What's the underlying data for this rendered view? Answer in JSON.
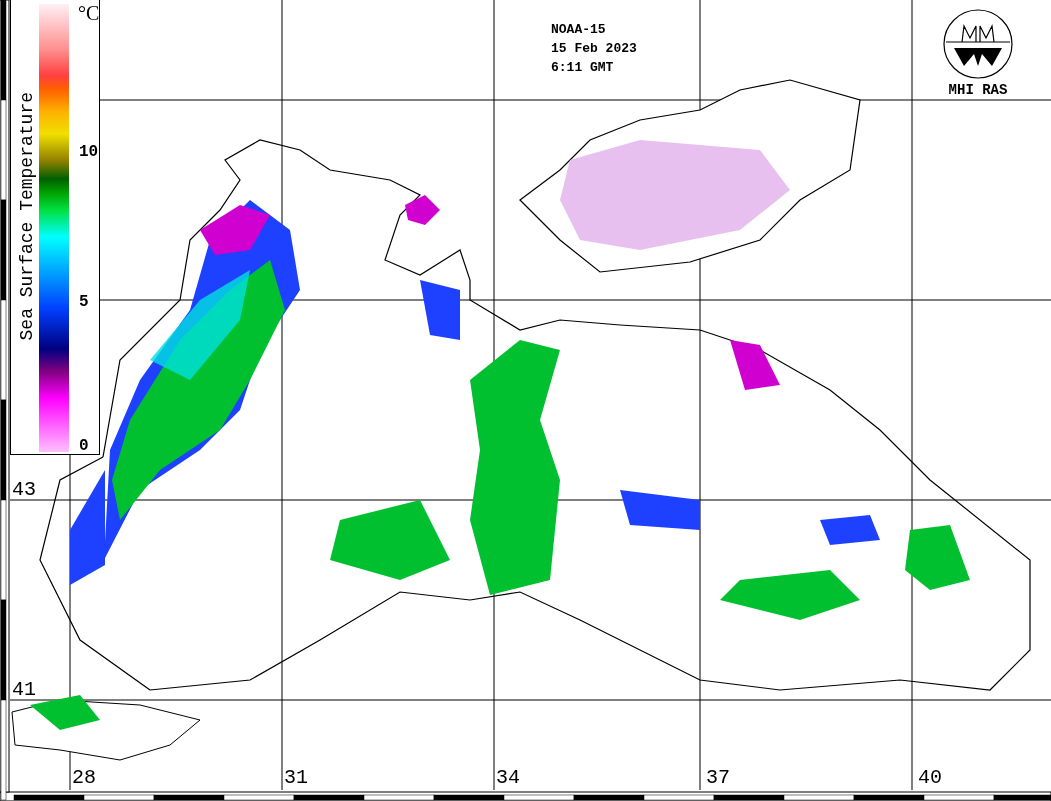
{
  "header": {
    "satellite": "NOAA-15",
    "date": "15 Feb 2023",
    "time": "6:11 GMT"
  },
  "logo": {
    "caption": "MHI RAS"
  },
  "legend": {
    "title": "Sea Surface Temperature",
    "unit": "°C",
    "ticks": [
      "10",
      "5",
      "0"
    ]
  },
  "latitude_labels": [
    "43",
    "41"
  ],
  "longitude_labels": [
    "28",
    "31",
    "34",
    "37",
    "40"
  ]
}
